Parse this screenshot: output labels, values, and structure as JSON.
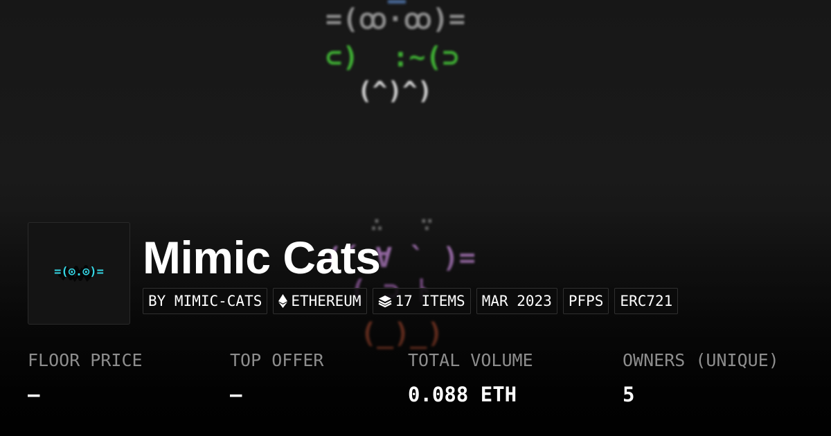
{
  "background_art": {
    "line1": "=(ꝏ·ꝏ)=",
    "line2": "⊂)  :~(⊃",
    "line3": "(^)^)",
    "line4": "∴   ∵",
    "line5": "(´ ∀ ` )=",
    "line6": "( ⊃ ﾄ",
    "line7": "(_)_)",
    "colors": {
      "gray": "#8e8e8e",
      "green": "#3fae34",
      "white": "#cfcfcf",
      "purple": "#b57fc6",
      "orange": "#c0573a"
    }
  },
  "collection": {
    "logo_text": "=(⊙.⊙)=",
    "logo_color": "#35d6e4",
    "title": "Mimic Cats"
  },
  "tags": [
    {
      "label": "BY MIMIC-CATS",
      "icon": ""
    },
    {
      "label": "ETHEREUM",
      "icon": "ethereum-icon"
    },
    {
      "label": "17 ITEMS",
      "icon": "layers-icon"
    },
    {
      "label": "MAR 2023",
      "icon": ""
    },
    {
      "label": "PFPS",
      "icon": ""
    },
    {
      "label": "ERC721",
      "icon": ""
    }
  ],
  "stats": [
    {
      "label": "FLOOR PRICE",
      "value": "—"
    },
    {
      "label": "TOP OFFER",
      "value": "—"
    },
    {
      "label": "TOTAL VOLUME",
      "value": "0.088 ETH"
    },
    {
      "label": "OWNERS (UNIQUE)",
      "value": "5"
    }
  ]
}
